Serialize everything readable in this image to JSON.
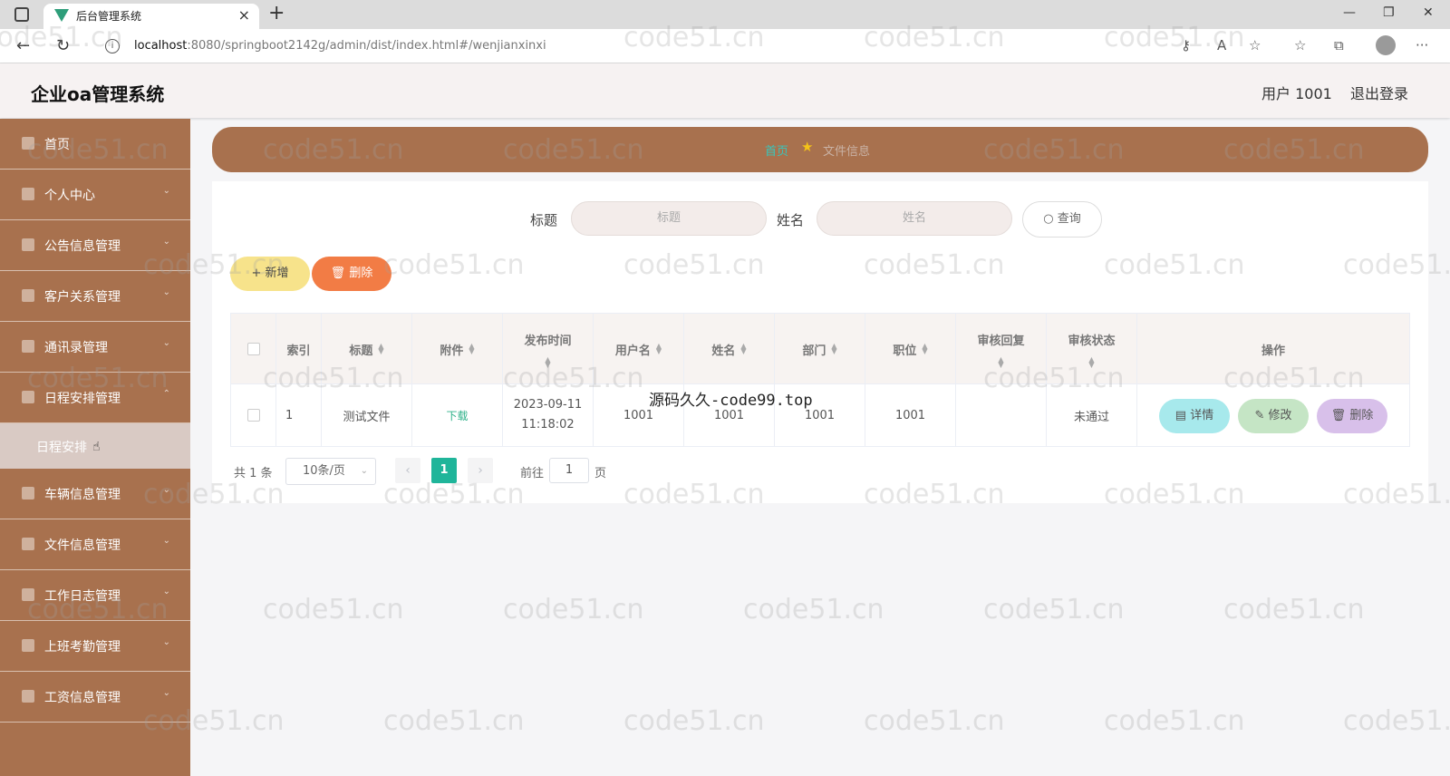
{
  "browser": {
    "tab_title": "后台管理系统",
    "url_host": "localhost",
    "url_rest": ":8080/springboot2142g/admin/dist/index.html#/wenjianxinxi"
  },
  "header": {
    "app_title": "企业oa管理系统",
    "user": "用户 1001",
    "logout": "退出登录"
  },
  "sidebar": {
    "items": [
      {
        "label": "首页"
      },
      {
        "label": "个人中心"
      },
      {
        "label": "公告信息管理"
      },
      {
        "label": "客户关系管理"
      },
      {
        "label": "通讯录管理"
      },
      {
        "label": "日程安排管理"
      },
      {
        "label": "车辆信息管理"
      },
      {
        "label": "文件信息管理"
      },
      {
        "label": "工作日志管理"
      },
      {
        "label": "上班考勤管理"
      },
      {
        "label": "工资信息管理"
      }
    ],
    "subitem": "日程安排"
  },
  "breadcrumb": {
    "home": "首页",
    "current": "文件信息"
  },
  "search": {
    "title_label": "标题",
    "title_placeholder": "标题",
    "name_label": "姓名",
    "name_placeholder": "姓名",
    "query_button": "查询"
  },
  "actions": {
    "add": "新增",
    "delete": "删除"
  },
  "table": {
    "headers": [
      "索引",
      "标题",
      "附件",
      "发布时间",
      "用户名",
      "姓名",
      "部门",
      "职位",
      "审核回复",
      "审核状态",
      "操作"
    ],
    "rows": [
      {
        "index": "1",
        "title": "测试文件",
        "attachment": "下载",
        "date": "2023-09-11",
        "time": "11:18:02",
        "username": "1001",
        "name": "1001",
        "department": "1001",
        "position": "1001",
        "reply": "",
        "status": "未通过",
        "detail": "详情",
        "edit": "修改",
        "delete": "删除"
      }
    ]
  },
  "pager": {
    "total": "共 1 条",
    "page_size": "10条/页",
    "current": "1",
    "goto_label": "前往",
    "goto_value": "1",
    "page_suffix": "页"
  },
  "overlay_text": "源码久久-code99.top",
  "watermark": "code51.cn",
  "colors": {
    "sidebar": "#a8714e",
    "accent": "#1fb59a",
    "add": "#f7e38b",
    "delete": "#f27c45"
  }
}
